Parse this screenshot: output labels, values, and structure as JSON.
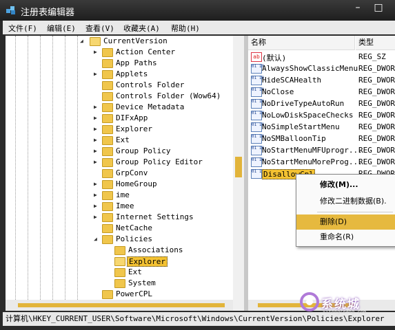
{
  "window": {
    "title": "注册表编辑器",
    "minimize_glyph": "–",
    "maximize_glyph": "□"
  },
  "menu": [
    "文件(F)",
    "编辑(E)",
    "查看(V)",
    "收藏夹(A)",
    "帮助(H)"
  ],
  "tree": {
    "root_label": "CurrentVersion",
    "children": [
      {
        "label": "Action Center",
        "expandable": true
      },
      {
        "label": "App Paths",
        "expandable": false
      },
      {
        "label": "Applets",
        "expandable": true
      },
      {
        "label": "Controls Folder",
        "expandable": false
      },
      {
        "label": "Controls Folder (Wow64)",
        "expandable": false
      },
      {
        "label": "Device Metadata",
        "expandable": true
      },
      {
        "label": "DIFxApp",
        "expandable": true
      },
      {
        "label": "Explorer",
        "expandable": true
      },
      {
        "label": "Ext",
        "expandable": true
      },
      {
        "label": "Group Policy",
        "expandable": true
      },
      {
        "label": "Group Policy Editor",
        "expandable": true
      },
      {
        "label": "GrpConv",
        "expandable": false
      },
      {
        "label": "HomeGroup",
        "expandable": true
      },
      {
        "label": "ime",
        "expandable": true
      },
      {
        "label": "Imee",
        "expandable": true
      },
      {
        "label": "Internet Settings",
        "expandable": true
      },
      {
        "label": "NetCache",
        "expandable": false
      },
      {
        "label": "Policies",
        "expandable": true
      }
    ],
    "policies_children": [
      {
        "label": "Associations"
      },
      {
        "label": "Explorer",
        "selected": true
      },
      {
        "label": "Ext"
      },
      {
        "label": "System"
      }
    ],
    "partial_label": "PowerCPL"
  },
  "list": {
    "columns": {
      "name": "名称",
      "type": "类型"
    },
    "rows": [
      {
        "icon": "ab",
        "name": "(默认)",
        "type": "REG_SZ"
      },
      {
        "icon": "bin",
        "name": "AlwaysShowClassicMenu",
        "type": "REG_DWOR"
      },
      {
        "icon": "bin",
        "name": "HideSCAHealth",
        "type": "REG_DWOR"
      },
      {
        "icon": "bin",
        "name": "NoClose",
        "type": "REG_DWOR"
      },
      {
        "icon": "bin",
        "name": "NoDriveTypeAutoRun",
        "type": "REG_DWOR"
      },
      {
        "icon": "bin",
        "name": "NoLowDiskSpaceChecks",
        "type": "REG_DWOR"
      },
      {
        "icon": "bin",
        "name": "NoSimpleStartMenu",
        "type": "REG_DWOR"
      },
      {
        "icon": "bin",
        "name": "NoSMBalloonTip",
        "type": "REG_DWOR"
      },
      {
        "icon": "bin",
        "name": "NoStartMenuMFUprogr...",
        "type": "REG_DWOR"
      },
      {
        "icon": "bin",
        "name": "NoStartMenuMoreProg...",
        "type": "REG_DWOR"
      },
      {
        "icon": "bin",
        "name": "DisallowCpl",
        "type": "REG_DWOR",
        "highlighted": true
      }
    ]
  },
  "context_menu": {
    "modify": "修改(M)...",
    "modify_binary": "修改二进制数据(B).",
    "delete": "删除(D)",
    "rename": "重命名(R)"
  },
  "status_bar": "计算机\\HKEY_CURRENT_USER\\Software\\Microsoft\\Windows\\CurrentVersion\\Policies\\Explorer",
  "watermark": {
    "text": "系统城",
    "sub": "xitongcheng.com"
  },
  "icons": {
    "app": "registry-cube-icon",
    "folder": "folder-icon",
    "expand": "triangle-right-icon",
    "expanded": "triangle-down-icon",
    "string_value": "ab-string-icon",
    "binary_value": "binary-dword-icon"
  },
  "colors": {
    "selection": "#f4c232",
    "scroll_thumb": "#e2b43a",
    "titlebar": "#1e1e1e"
  }
}
